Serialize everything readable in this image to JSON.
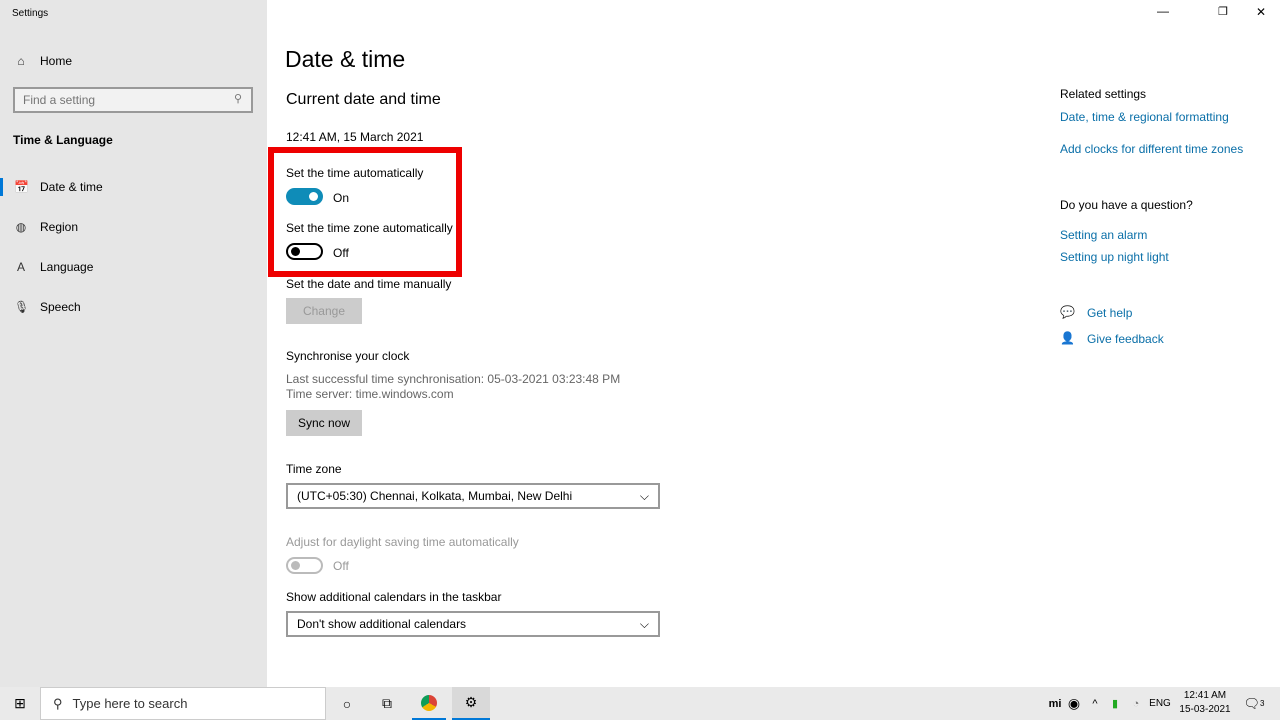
{
  "window": {
    "title": "Settings",
    "minimize": "—",
    "restore": "❐",
    "close": "✕"
  },
  "sidebar": {
    "home": "Home",
    "search_placeholder": "Find a setting",
    "section": "Time & Language",
    "items": [
      {
        "label": "Date & time",
        "icon": "calendar-clock-icon"
      },
      {
        "label": "Region",
        "icon": "globe-icon"
      },
      {
        "label": "Language",
        "icon": "language-icon"
      },
      {
        "label": "Speech",
        "icon": "microphone-icon"
      }
    ]
  },
  "main": {
    "title": "Date & time",
    "subtitle": "Current date and time",
    "current": "12:41 AM, 15 March 2021",
    "auto_time_label": "Set the time automatically",
    "auto_time_state": "On",
    "auto_tz_label": "Set the time zone automatically",
    "auto_tz_state": "Off",
    "manual_label": "Set the date and time manually",
    "change_button": "Change",
    "sync_title": "Synchronise your clock",
    "sync_last": "Last successful time synchronisation: 05-03-2021 03:23:48 PM",
    "sync_server": "Time server: time.windows.com",
    "sync_button": "Sync now",
    "tz_label": "Time zone",
    "tz_value": "(UTC+05:30) Chennai, Kolkata, Mumbai, New Delhi",
    "dst_label": "Adjust for daylight saving time automatically",
    "dst_state": "Off",
    "cal_label": "Show additional calendars in the taskbar",
    "cal_value": "Don't show additional calendars"
  },
  "related": {
    "title": "Related settings",
    "links": [
      "Date, time & regional formatting",
      "Add clocks for different time zones"
    ],
    "question": "Do you have a question?",
    "help_links": [
      "Setting an alarm",
      "Setting up night light"
    ],
    "get_help": "Get help",
    "feedback": "Give feedback"
  },
  "taskbar": {
    "search_placeholder": "Type here to search",
    "lang": "ENG",
    "time": "12:41 AM",
    "date": "15-03-2021",
    "notifications": "3",
    "tray_brand": "mi"
  },
  "colors": {
    "accent": "#0f8cb8",
    "highlight": "#ee0000"
  }
}
